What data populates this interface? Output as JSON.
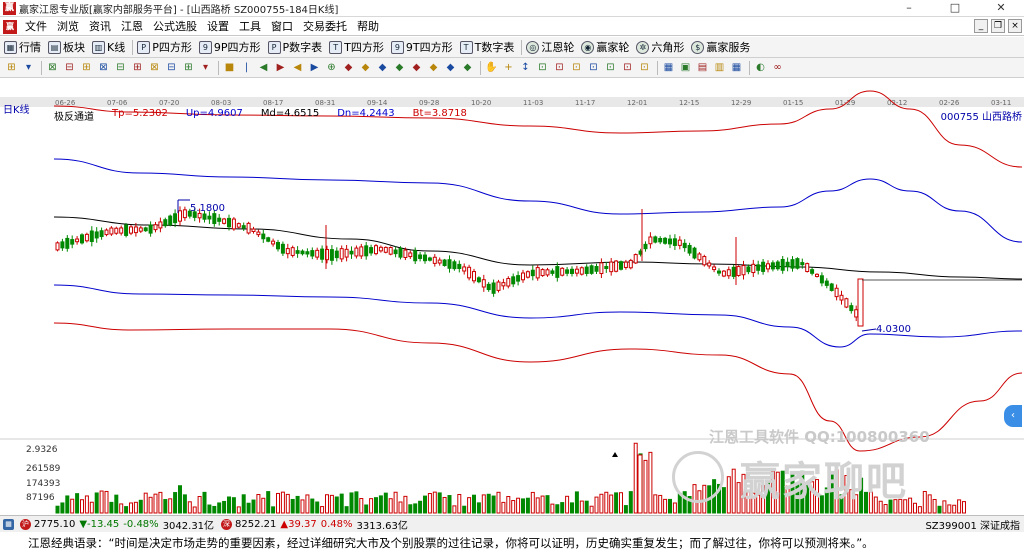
{
  "window": {
    "title": "赢家江恩专业版[赢家内部服务平台] - [山西路桥  SZ000755-184日K线]",
    "controls": {
      "minimize": "–",
      "maximize": "□",
      "close": "✕"
    }
  },
  "menubar": {
    "items": [
      "文件",
      "浏览",
      "资讯",
      "江恩",
      "公式选股",
      "设置",
      "工具",
      "窗口",
      "交易委托",
      "帮助"
    ],
    "mdi_controls": [
      "_",
      "❐",
      "×"
    ]
  },
  "toolbar1": {
    "items": [
      {
        "label": "行情",
        "icon": "grid-icon",
        "glyph": "▦"
      },
      {
        "label": "板块",
        "icon": "blocks-icon",
        "glyph": "▤"
      },
      {
        "label": "K线",
        "icon": "kline-icon",
        "glyph": "▥"
      },
      {
        "label": "P四方形",
        "icon": "p-square-icon",
        "glyph": "P"
      },
      {
        "label": "9P四方形",
        "icon": "9p-square-icon",
        "glyph": "9"
      },
      {
        "label": "P数字表",
        "icon": "p-table-icon",
        "glyph": "P"
      },
      {
        "label": "T四方形",
        "icon": "t-square-icon",
        "glyph": "T"
      },
      {
        "label": "9T四方形",
        "icon": "9t-square-icon",
        "glyph": "9"
      },
      {
        "label": "T数字表",
        "icon": "t-table-icon",
        "glyph": "T"
      },
      {
        "label": "江恩轮",
        "icon": "gann-wheel-icon",
        "glyph": "◎"
      },
      {
        "label": "赢家轮",
        "icon": "winner-wheel-icon",
        "glyph": "◉"
      },
      {
        "label": "六角形",
        "icon": "hexagon-icon",
        "glyph": "✲"
      },
      {
        "label": "赢家服务",
        "icon": "service-icon",
        "glyph": "$"
      }
    ]
  },
  "toolbar2": {
    "buttons": [
      "⊞",
      "▾",
      "⊠",
      "⊟",
      "⊞",
      "⊠",
      "⊟",
      "⊞",
      "⊠",
      "⊟",
      "⊞",
      "▾",
      "■",
      "|",
      "◀",
      "▶",
      "◀",
      "▶",
      "⊕",
      "◆",
      "◆",
      "◆",
      "◆",
      "◆",
      "◆",
      "◆",
      "◆",
      "✋",
      "+",
      "↕",
      "⊡",
      "⊡",
      "⊡",
      "⊡",
      "⊡",
      "⊡",
      "⊡",
      "▦",
      "▣",
      "▤",
      "▥",
      "▦",
      "◐",
      "∞"
    ]
  },
  "chart": {
    "period_label": "日K线",
    "indicator": {
      "name": "极反通道",
      "tp": "Tp=5.2302",
      "up": "Up=4.9607",
      "md": "Md=4.6515",
      "dn": "Dn=4.2443",
      "bt": "Bt=3.8718"
    },
    "stock_ref": "000755  山西路桥",
    "high_annotation": "5.1800",
    "low_annotation": "4.0300",
    "colors": {
      "up_candle": "#cc0000",
      "down_candle": "#008800",
      "upper": "#cc0000",
      "upper_inner": "#0000cc",
      "mid": "#000000"
    }
  },
  "chart_data": {
    "type": "line",
    "title": "极反通道",
    "dates": [
      "06-26",
      "07-06",
      "07-20",
      "08-03",
      "08-17",
      "08-31",
      "09-14",
      "09-28",
      "10-20",
      "11-03",
      "11-17",
      "12-01",
      "12-15",
      "12-29",
      "01-15",
      "01-29",
      "02-12",
      "02-26",
      "03-11"
    ],
    "series": [
      {
        "name": "Tp",
        "last": 5.2302
      },
      {
        "name": "Up",
        "last": 4.9607
      },
      {
        "name": "Md",
        "last": 4.6515
      },
      {
        "name": "Dn",
        "last": 4.2443
      },
      {
        "name": "Bt",
        "last": 3.8718
      }
    ],
    "annotations": [
      {
        "text": "5.1800"
      },
      {
        "text": "4.0300"
      }
    ],
    "volume_axis": [
      "2.9326",
      "261589",
      "174393",
      "87196"
    ]
  },
  "watermark": {
    "line1": "江恩工具软件   QQ:100800360",
    "line2": "赢家聊吧"
  },
  "statusbar": {
    "sh_index": "2775.10",
    "sh_change": "▼-13.45",
    "sh_pct": "-0.48%",
    "sh_amount": "3042.31亿",
    "sz_index": "8252.21",
    "sz_change": "▲39.37",
    "sz_pct": "0.48%",
    "sz_amount": "3313.63亿",
    "right": "SZ399001 深证成指"
  },
  "quote": "江恩经典语录：“时间是决定市场走势的重要因素，经过详细研究大市及个别股票的过往记录，你将可以证明，历史确实重复发生；而了解过往，你将可以预测将来。”。"
}
